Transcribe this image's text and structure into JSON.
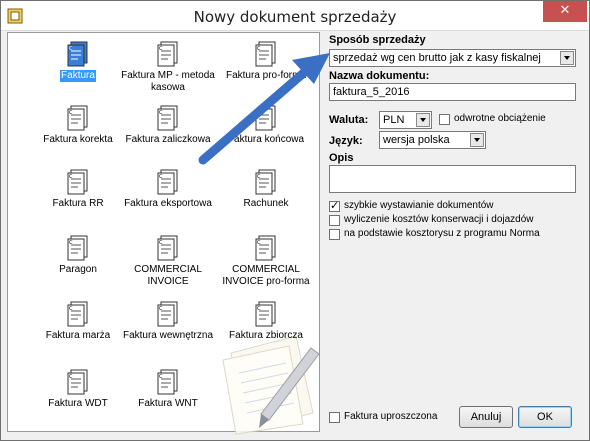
{
  "window": {
    "title": "Nowy dokument sprzedaży",
    "close_label": "✕"
  },
  "documents": [
    {
      "label": "Faktura",
      "selected": true,
      "color": "#3a7fd4"
    },
    {
      "label": "Faktura MP - metoda kasowa"
    },
    {
      "label": "Faktura pro-forma"
    },
    {
      "label": "Faktura korekta"
    },
    {
      "label": "Faktura zaliczkowa"
    },
    {
      "label": "Faktura końcowa"
    },
    {
      "label": "Faktura RR"
    },
    {
      "label": "Faktura eksportowa"
    },
    {
      "label": "Rachunek"
    },
    {
      "label": "Paragon"
    },
    {
      "label": "COMMERCIAL INVOICE"
    },
    {
      "label": "COMMERCIAL INVOICE pro-forma"
    },
    {
      "label": "Faktura marża"
    },
    {
      "label": "Faktura wewnętrzna"
    },
    {
      "label": "Faktura zbiorcza"
    },
    {
      "label": "Faktura WDT"
    },
    {
      "label": "Faktura WNT"
    }
  ],
  "form": {
    "sposob_label": "Sposób sprzedaży",
    "sposob_value": "sprzedaż wg cen brutto jak z kasy fiskalnej",
    "nazwa_label": "Nazwa dokumentu:",
    "nazwa_value": "faktura_5_2016",
    "waluta_label": "Waluta:",
    "waluta_value": "PLN",
    "odwrotne_label": "odwrotne obciążenie",
    "odwrotne_checked": false,
    "jezyk_label": "Język:",
    "jezyk_value": "wersja polska",
    "opis_label": "Opis",
    "opis_value": "",
    "options": [
      {
        "label": "szybkie wystawianie dokumentów",
        "checked": true
      },
      {
        "label": "wyliczenie kosztów konserwacji i dojazdów",
        "checked": false
      },
      {
        "label": "na podstawie kosztorysu z programu Norma",
        "checked": false
      }
    ],
    "uproszczona_label": "Faktura uproszczona",
    "uproszczona_checked": false
  },
  "buttons": {
    "cancel": "Anuluj",
    "ok": "OK"
  },
  "colors": {
    "arrow": "#3a6fc4",
    "selection": "#3399ff",
    "close": "#c75050"
  }
}
